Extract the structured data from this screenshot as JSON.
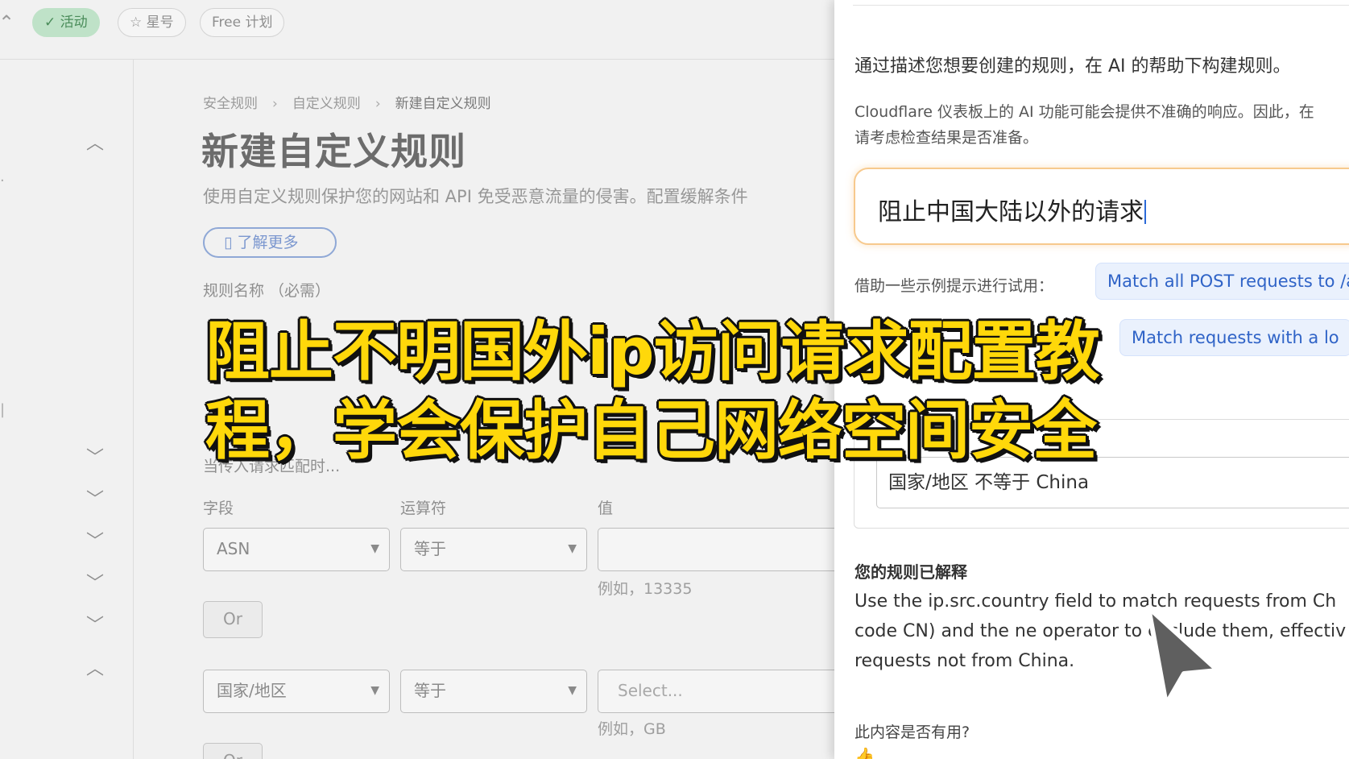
{
  "topbar": {
    "pills": [
      {
        "icon": "check-icon",
        "label": "活动",
        "active": true
      },
      {
        "icon": "star-icon",
        "label": "星号",
        "active": false
      },
      {
        "icon": "",
        "label": "Free 计划",
        "active": false
      }
    ]
  },
  "breadcrumb": [
    "安全规则",
    "自定义规则",
    "新建自定义规则"
  ],
  "page": {
    "title": "新建自定义规则",
    "description": "使用自定义规则保护您的网站和 API 免受恶意流量的侵害。配置缓解条件",
    "learn_more": "了解更多",
    "rule_name_label": "规则名称 （必需）",
    "match_label": "当传入请求匹配时...",
    "col_field": "字段",
    "col_operator": "运算符",
    "col_value": "值",
    "row1": {
      "field": "ASN",
      "operator": "等于",
      "value": "",
      "hint": "例如，13335"
    },
    "or_label": "Or",
    "row2": {
      "field": "国家/地区",
      "operator": "等于",
      "value_placeholder": "Select...",
      "hint": "例如，GB"
    },
    "or_label_2": "Or"
  },
  "ai_panel": {
    "intro": "通过描述您想要创建的规则，在 AI 的帮助下构建规则。",
    "disclaimer_line1": "Cloudflare 仪表板上的 AI 功能可能会提供不准确的响应。因此，在",
    "disclaimer_line2": "请考虑检查结果是否准备。",
    "prompt_value": "阻止中国大陆以外的请求",
    "examples_label": "借助一些示例提示进行试用：",
    "examples": [
      "Match all POST requests to /a",
      "Match requests with a lo"
    ],
    "expression": "国家/地区 不等于 China",
    "explained_title": "您的规则已解释",
    "explanation_lines": [
      "Use the ip.src.country field to match requests from Ch",
      "code CN) and the ne operator to exclude them, effectiv",
      "requests not from China."
    ],
    "helpful_question": "此内容是否有用?"
  },
  "overlay": {
    "headline_line1": "阻止不明国外ip访问请求配置教",
    "headline_line2": "程，学会保护自己网络空间安全"
  },
  "colors": {
    "headline": "#ffd80a",
    "accent_blue": "#2f63c7",
    "prompt_border": "#f7c98d",
    "active_pill": "#bfe2c8"
  }
}
